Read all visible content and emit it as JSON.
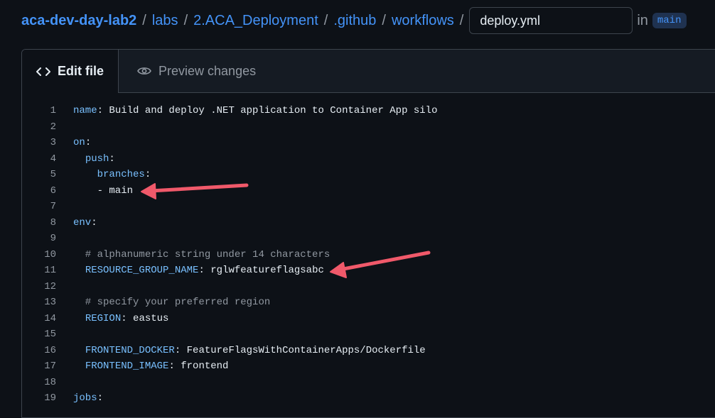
{
  "breadcrumb": {
    "items": [
      "aca-dev-day-lab2",
      "labs",
      "2.ACA_Deployment",
      ".github",
      "workflows"
    ],
    "separator": "/"
  },
  "file": {
    "name": "deploy.yml",
    "in_label": "in",
    "branch": "main"
  },
  "tabs": [
    {
      "label": "Edit file",
      "icon": "code-icon"
    },
    {
      "label": "Preview changes",
      "icon": "eye-icon"
    }
  ],
  "code_lines": [
    [
      {
        "t": "k",
        "v": "name"
      },
      {
        "t": "p",
        "v": ": Build and deploy .NET application to Container App silo"
      }
    ],
    [],
    [
      {
        "t": "k",
        "v": "on"
      },
      {
        "t": "p",
        "v": ":"
      }
    ],
    [
      {
        "t": "p",
        "v": "  "
      },
      {
        "t": "k",
        "v": "push"
      },
      {
        "t": "p",
        "v": ":"
      }
    ],
    [
      {
        "t": "p",
        "v": "    "
      },
      {
        "t": "k",
        "v": "branches"
      },
      {
        "t": "p",
        "v": ":"
      }
    ],
    [
      {
        "t": "p",
        "v": "    - main"
      }
    ],
    [],
    [
      {
        "t": "k",
        "v": "env"
      },
      {
        "t": "p",
        "v": ":"
      }
    ],
    [],
    [
      {
        "t": "c",
        "v": "  # alphanumeric string under 14 characters"
      }
    ],
    [
      {
        "t": "p",
        "v": "  "
      },
      {
        "t": "k",
        "v": "RESOURCE_GROUP_NAME"
      },
      {
        "t": "p",
        "v": ": rglwfeatureflagsabc"
      }
    ],
    [],
    [
      {
        "t": "c",
        "v": "  # specify your preferred region"
      }
    ],
    [
      {
        "t": "p",
        "v": "  "
      },
      {
        "t": "k",
        "v": "REGION"
      },
      {
        "t": "p",
        "v": ": eastus"
      }
    ],
    [],
    [
      {
        "t": "p",
        "v": "  "
      },
      {
        "t": "k",
        "v": "FRONTEND_DOCKER"
      },
      {
        "t": "p",
        "v": ": FeatureFlagsWithContainerApps/Dockerfile"
      }
    ],
    [
      {
        "t": "p",
        "v": "  "
      },
      {
        "t": "k",
        "v": "FRONTEND_IMAGE"
      },
      {
        "t": "p",
        "v": ": frontend"
      }
    ],
    [],
    [
      {
        "t": "k",
        "v": "jobs"
      },
      {
        "t": "p",
        "v": ":"
      }
    ]
  ],
  "colors": {
    "background": "#0d1117",
    "link": "#4493f8",
    "yaml_key": "#79c0ff",
    "comment": "#9198a1",
    "annotation_arrow": "#f0596a"
  }
}
